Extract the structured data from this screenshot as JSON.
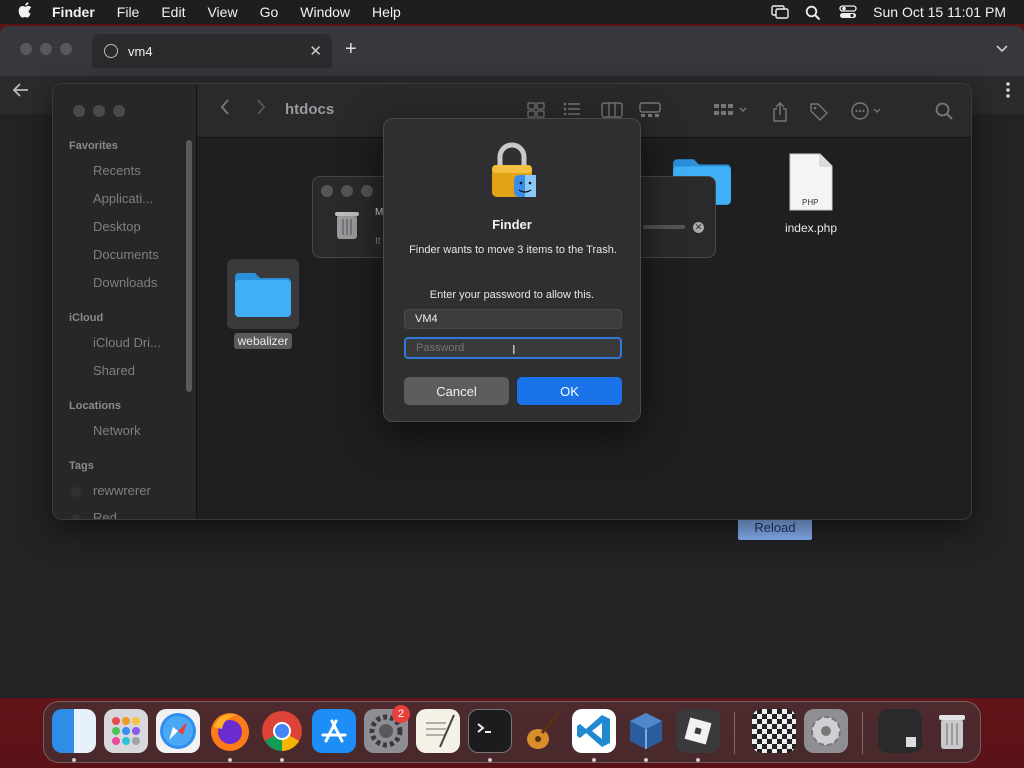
{
  "menubar": {
    "app_name": "Finder",
    "items": [
      "File",
      "Edit",
      "View",
      "Go",
      "Window",
      "Help"
    ],
    "clock": "Sun Oct 15  11:01 PM"
  },
  "browser": {
    "tab_title": "vm4",
    "reload_label": "Reload"
  },
  "finder": {
    "path_title": "htdocs",
    "sidebar": {
      "favorites_header": "Favorites",
      "favorites": [
        "Recents",
        "Applicati...",
        "Desktop",
        "Documents",
        "Downloads"
      ],
      "icloud_header": "iCloud",
      "icloud": [
        "iCloud Dri...",
        "Shared"
      ],
      "locations_header": "Locations",
      "locations": [
        "Network"
      ],
      "tags_header": "Tags",
      "tags": [
        "rewwrerer",
        "Red"
      ]
    },
    "files": [
      {
        "name": "webalizer",
        "kind": "folder"
      },
      {
        "name": "index.php",
        "kind": "php"
      }
    ],
    "php_badge": "PHP"
  },
  "progress": {
    "label_fragment": "M",
    "sub_fragment": "It"
  },
  "dialog": {
    "title": "Finder",
    "message": "Finder wants to move 3 items to the Trash.",
    "prompt": "Enter your password to allow this.",
    "username_value": "VM4",
    "password_placeholder": "Password",
    "cancel_label": "Cancel",
    "ok_label": "OK"
  },
  "dock": {
    "apps": [
      "finder-icon",
      "launchpad-icon",
      "safari-icon",
      "firefox-icon",
      "chrome-icon",
      "app-store-icon",
      "system-settings-icon",
      "textedit-icon",
      "terminal-icon",
      "garageband-icon",
      "vscode-icon",
      "virtualbox-icon",
      "roblox-icon",
      "chess-icon",
      "settings-gear-icon",
      "screenshot-icon",
      "trash-icon"
    ],
    "settings_badge": "2"
  },
  "colors": {
    "accent": "#1a73e8",
    "focus_ring": "#2f7ad7",
    "folder_blue": "#3fa9f5"
  }
}
